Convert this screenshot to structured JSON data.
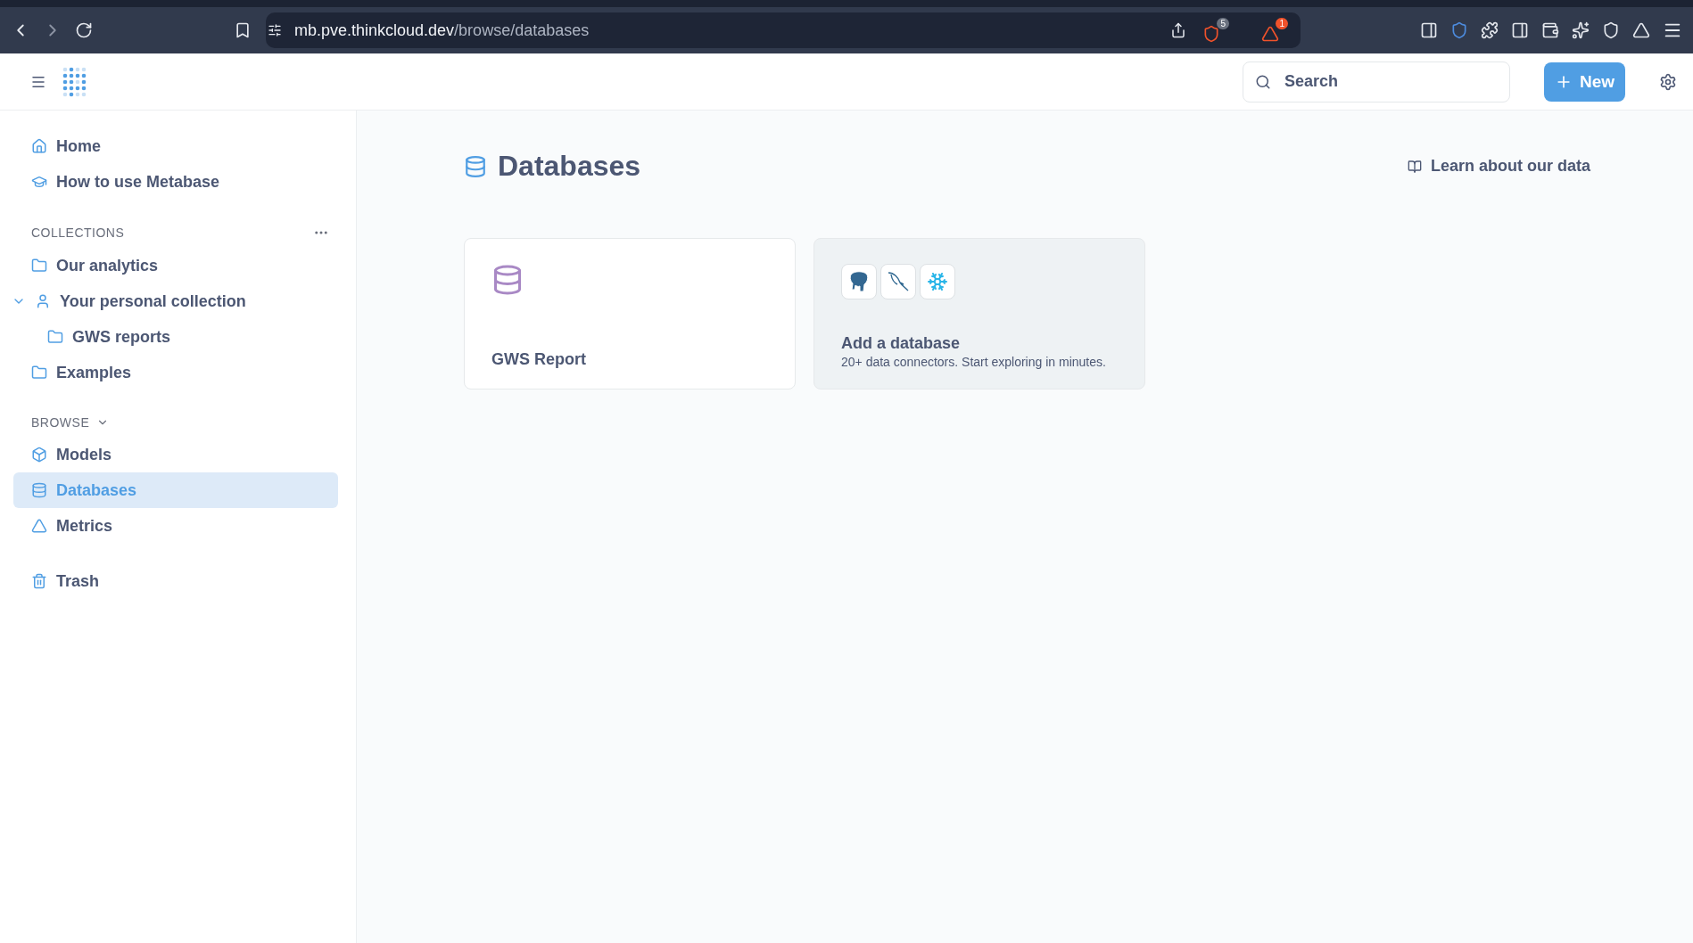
{
  "browser": {
    "url_host": "mb.pve.thinkcloud.dev",
    "url_path": "/browse/databases",
    "shield_count": "5",
    "alert_count": "1"
  },
  "header": {
    "search": {
      "placeholder": "Search"
    },
    "new_button": "New"
  },
  "sidebar": {
    "top_items": [
      {
        "kind": "home",
        "label": "Home",
        "selected": false
      },
      {
        "kind": "learn",
        "label": "How to use Metabase",
        "selected": false
      }
    ],
    "collections_heading": "COLLECTIONS",
    "collections": [
      {
        "kind": "folder",
        "label": "Our analytics",
        "selected": false
      },
      {
        "kind": "person",
        "label": "Your personal collection",
        "selected": false,
        "expanded": true,
        "children": [
          {
            "kind": "folder",
            "label": "GWS reports",
            "selected": false
          }
        ]
      },
      {
        "kind": "folder",
        "label": "Examples",
        "selected": false
      }
    ],
    "browse_heading": "BROWSE",
    "browse_items": [
      {
        "kind": "model",
        "label": "Models",
        "selected": false
      },
      {
        "kind": "database",
        "label": "Databases",
        "selected": true
      },
      {
        "kind": "metric",
        "label": "Metrics",
        "selected": false
      }
    ],
    "trash": {
      "kind": "trash",
      "label": "Trash",
      "selected": false
    }
  },
  "main": {
    "title": "Databases",
    "learn_link": "Learn about our data",
    "cards": [
      {
        "kind": "database",
        "name": "GWS Report"
      },
      {
        "kind": "add",
        "name": "Add a database",
        "description": "20+ data connectors. Start exploring in minutes."
      }
    ]
  }
}
